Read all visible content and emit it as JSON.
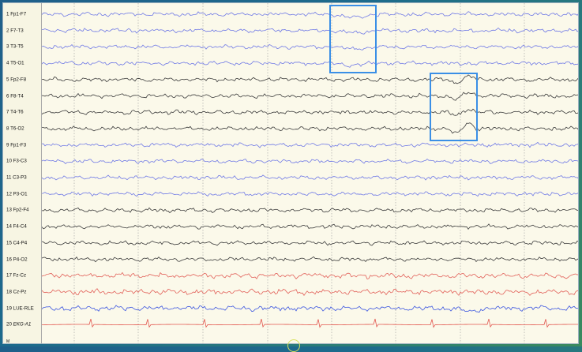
{
  "channels": [
    {
      "num": "1",
      "name": "Fp1-F7",
      "color": "#6f79e6"
    },
    {
      "num": "2",
      "name": "F7-T3",
      "color": "#6f79e6"
    },
    {
      "num": "3",
      "name": "T3-T5",
      "color": "#6f79e6"
    },
    {
      "num": "4",
      "name": "T5-O1",
      "color": "#6f79e6"
    },
    {
      "num": "5",
      "name": "Fp2-F8",
      "color": "#3b3b3b"
    },
    {
      "num": "6",
      "name": "F8-T4",
      "color": "#3b3b3b"
    },
    {
      "num": "7",
      "name": "T4-T6",
      "color": "#3b3b3b"
    },
    {
      "num": "8",
      "name": "T6-O2",
      "color": "#3b3b3b"
    },
    {
      "num": "9",
      "name": "Fp1-F3",
      "color": "#6f79e6"
    },
    {
      "num": "10",
      "name": "F3-C3",
      "color": "#6f79e6"
    },
    {
      "num": "11",
      "name": "C3-P3",
      "color": "#6f79e6"
    },
    {
      "num": "12",
      "name": "P3-O1",
      "color": "#6f79e6"
    },
    {
      "num": "13",
      "name": "Fp2-F4",
      "color": "#3b3b3b"
    },
    {
      "num": "14",
      "name": "F4-C4",
      "color": "#3b3b3b"
    },
    {
      "num": "15",
      "name": "C4-P4",
      "color": "#3b3b3b"
    },
    {
      "num": "16",
      "name": "P4-O2",
      "color": "#3b3b3b"
    },
    {
      "num": "17",
      "name": "Fz-Cz",
      "color": "#e2615a"
    },
    {
      "num": "18",
      "name": "Cz-Pz",
      "color": "#e2615a"
    },
    {
      "num": "19",
      "name": "LUE-RLE",
      "color": "#3b55e0"
    },
    {
      "num": "20",
      "name": "EKG-A1",
      "color": "#e2574f",
      "italic": true
    }
  ],
  "bottom_marker_label": "M",
  "highlight_color": "#3a8fe6",
  "grid_color": "#9a9a9a"
}
